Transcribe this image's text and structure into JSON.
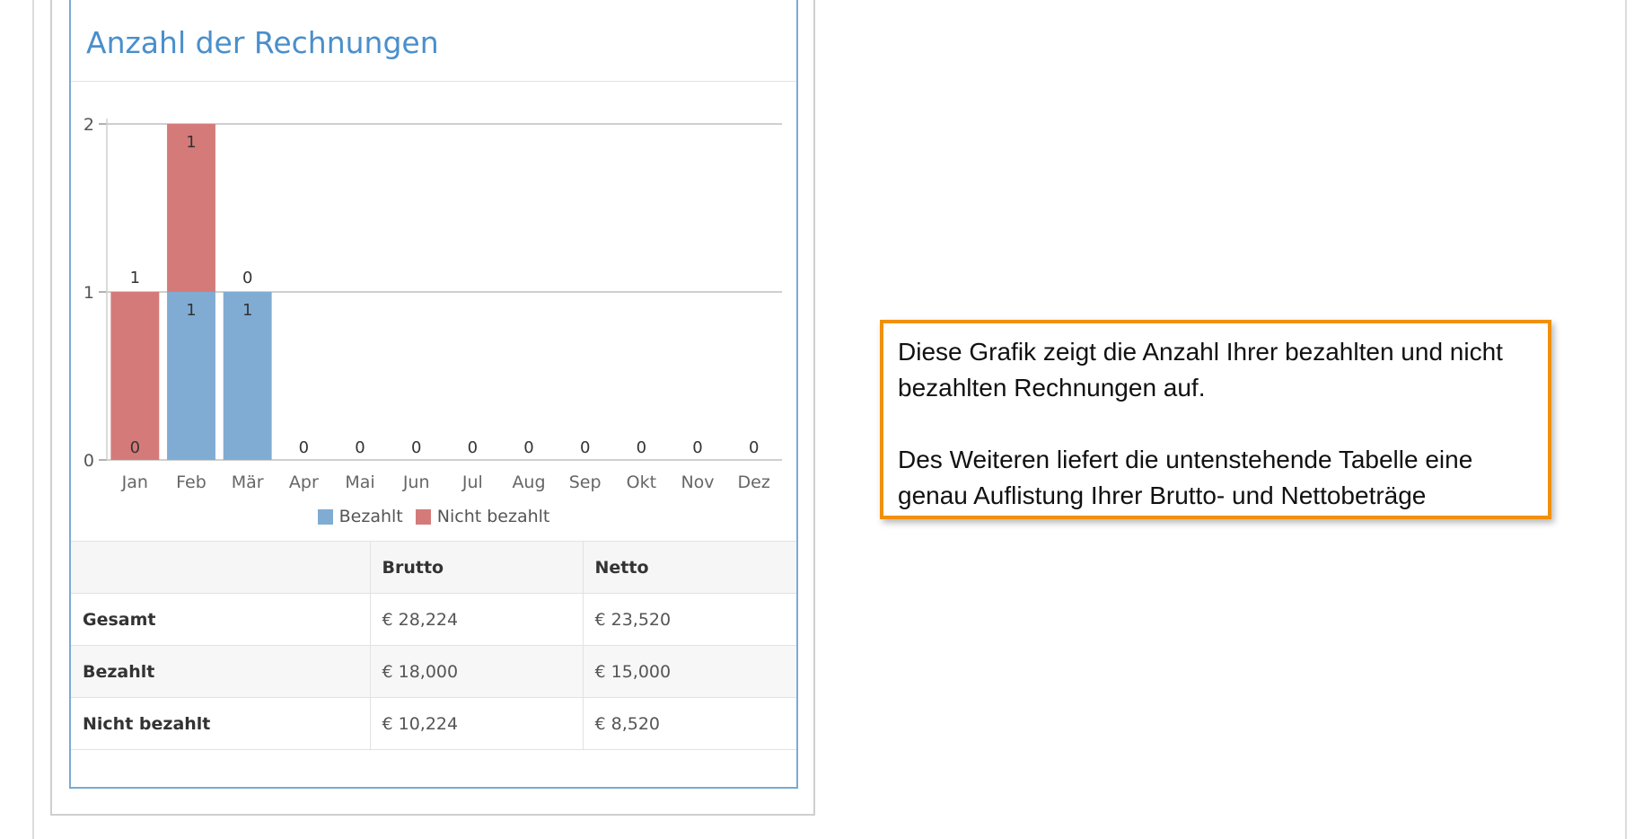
{
  "panel": {
    "title": "Anzahl der Rechnungen"
  },
  "chart_data": {
    "type": "bar",
    "stacked": true,
    "categories": [
      "Jan",
      "Feb",
      "Mär",
      "Apr",
      "Mai",
      "Jun",
      "Jul",
      "Aug",
      "Sep",
      "Okt",
      "Nov",
      "Dez"
    ],
    "series": [
      {
        "name": "Bezahlt",
        "color": "#80acd3",
        "values": [
          0,
          1,
          1,
          0,
          0,
          0,
          0,
          0,
          0,
          0,
          0,
          0
        ]
      },
      {
        "name": "Nicht bezahlt",
        "color": "#d47b79",
        "values": [
          1,
          1,
          0,
          0,
          0,
          0,
          0,
          0,
          0,
          0,
          0,
          0
        ]
      }
    ],
    "ylim": [
      0,
      2
    ],
    "yticks": [
      0,
      1,
      2
    ],
    "grid": true,
    "legend": "bottom"
  },
  "table": {
    "columns": [
      "",
      "Brutto",
      "Netto"
    ],
    "rows": [
      [
        "Gesamt",
        "€ 28,224",
        "€ 23,520"
      ],
      [
        "Bezahlt",
        "€ 18,000",
        "€ 15,000"
      ],
      [
        "Nicht bezahlt",
        "€ 10,224",
        "€ 8,520"
      ]
    ]
  },
  "info_box": {
    "paragraph1": "Diese Grafik zeigt die Anzahl Ihrer bezahlten und nicht bezahlten Rechnungen auf.",
    "paragraph2": "Des Weiteren liefert die untenstehende Tabelle eine genau Auflistung Ihrer Brutto- und Nettobeträge"
  }
}
